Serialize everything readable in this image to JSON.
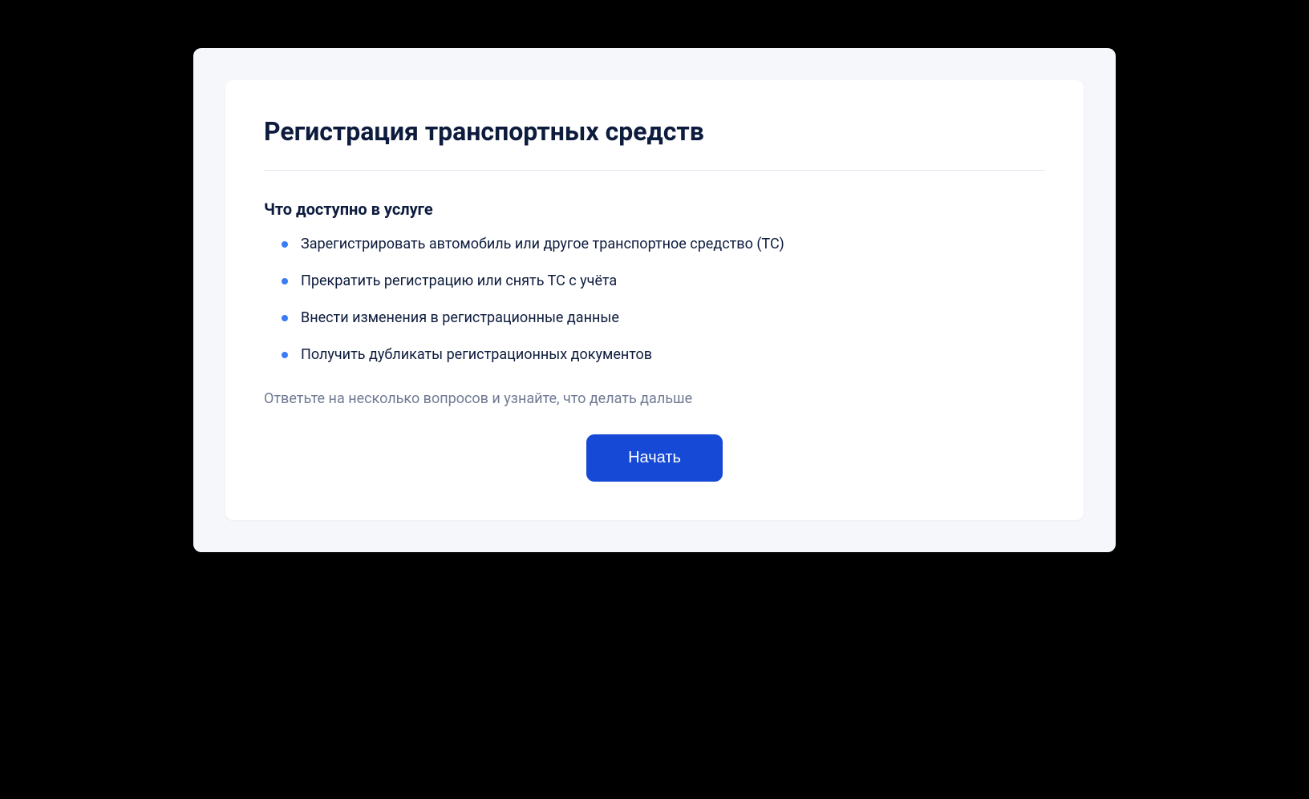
{
  "page": {
    "title": "Регистрация транспортных средств",
    "section_heading": "Что доступно в услуге",
    "features": [
      "Зарегистрировать автомобиль или другое транспортное средство (ТС)",
      "Прекратить регистрацию или снять ТС с учёта",
      "Внести изменения в регистрационные данные",
      "Получить дубликаты регистрационных документов"
    ],
    "hint": "Ответьте на несколько вопросов и узнайте, что делать дальше",
    "start_button": "Начать"
  }
}
